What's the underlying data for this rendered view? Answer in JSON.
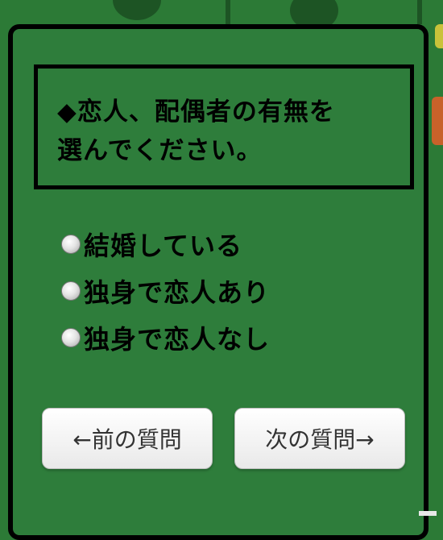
{
  "question": {
    "line1": "◆恋人、配偶者の有無を",
    "line2": "選んでください。"
  },
  "options": [
    {
      "label": "結婚している"
    },
    {
      "label": "独身で恋人あり"
    },
    {
      "label": "独身で恋人なし"
    }
  ],
  "nav": {
    "prev_label": "←前の質問",
    "next_label": "次の質問→"
  },
  "colors": {
    "background": "#2c7a36",
    "panel": "#2e7d3b",
    "border": "#000000",
    "button": "#ffffff"
  }
}
